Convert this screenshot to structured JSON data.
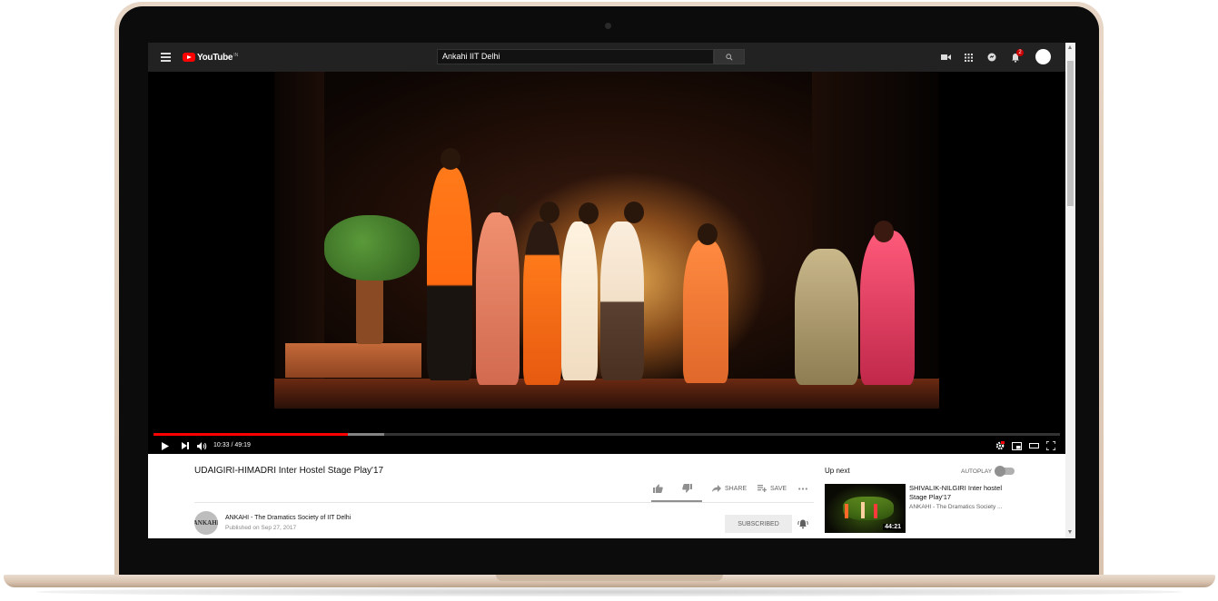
{
  "header": {
    "logo_text": "YouTube",
    "logo_tm": "IN",
    "search_value": "Ankahi IIT Delhi",
    "notification_count": "2",
    "icons": [
      "menu-icon",
      "search-icon",
      "video-camera-icon",
      "apps-grid-icon",
      "messages-icon",
      "bell-icon",
      "avatar"
    ]
  },
  "player": {
    "time": "10:33 / 49:19",
    "progress_fraction": 0.214,
    "loaded_fraction": 0.255,
    "icons": [
      "play-icon",
      "next-icon",
      "volume-icon",
      "settings-icon",
      "miniplayer-icon",
      "theater-icon",
      "fullscreen-icon"
    ]
  },
  "video": {
    "title": "UDAIGIRI-HIMADRI Inter Hostel Stage Play'17",
    "share_label": "SHARE",
    "save_label": "SAVE",
    "channel_name": "ANKAHI - The Dramatics Society of IIT Delhi",
    "channel_avatar_text": "ANKAHI",
    "published": "Published on Sep 27, 2017",
    "subscribe_label": "SUBSCRIBED"
  },
  "sidebar": {
    "up_next_label": "Up next",
    "autoplay_label": "AUTOPLAY",
    "autoplay_on": false,
    "items": [
      {
        "title": "SHIVALIK-NILGIRI Inter hostel Stage Play'17",
        "channel": "ANKAHI - The Dramatics Society ...",
        "duration": "44:21"
      }
    ]
  },
  "colors": {
    "topbar": "#222222",
    "accent_red": "#ff0000",
    "subscribed_bg": "#ececec"
  }
}
